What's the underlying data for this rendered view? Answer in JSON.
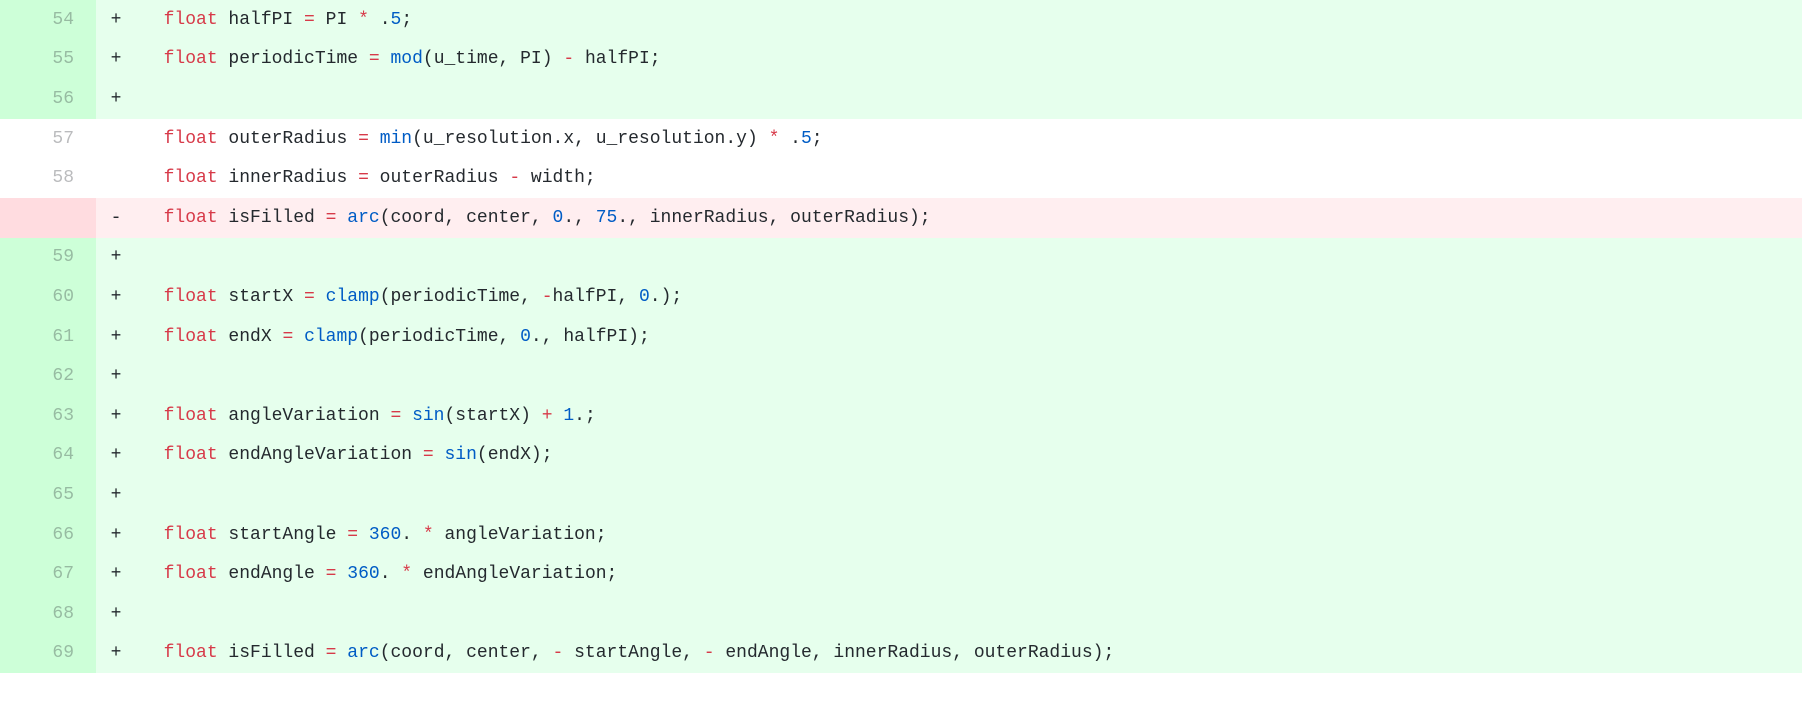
{
  "diff": {
    "lines": [
      {
        "id": "l54",
        "lineno": "54",
        "marker": "+",
        "kind": "add",
        "tokens": [
          {
            "cls": "tok-plain",
            "t": "  "
          },
          {
            "cls": "tok-red",
            "t": "float"
          },
          {
            "cls": "tok-plain",
            "t": " halfPI "
          },
          {
            "cls": "tok-red",
            "t": "="
          },
          {
            "cls": "tok-plain",
            "t": " PI "
          },
          {
            "cls": "tok-red",
            "t": "*"
          },
          {
            "cls": "tok-plain",
            "t": " ."
          },
          {
            "cls": "tok-blue",
            "t": "5"
          },
          {
            "cls": "tok-plain",
            "t": ";"
          }
        ]
      },
      {
        "id": "l55",
        "lineno": "55",
        "marker": "+",
        "kind": "add",
        "tokens": [
          {
            "cls": "tok-plain",
            "t": "  "
          },
          {
            "cls": "tok-red",
            "t": "float"
          },
          {
            "cls": "tok-plain",
            "t": " periodicTime "
          },
          {
            "cls": "tok-red",
            "t": "="
          },
          {
            "cls": "tok-plain",
            "t": " "
          },
          {
            "cls": "tok-blue",
            "t": "mod"
          },
          {
            "cls": "tok-plain",
            "t": "(u_time, PI) "
          },
          {
            "cls": "tok-red",
            "t": "-"
          },
          {
            "cls": "tok-plain",
            "t": " halfPI;"
          }
        ]
      },
      {
        "id": "l56",
        "lineno": "56",
        "marker": "+",
        "kind": "add",
        "tokens": []
      },
      {
        "id": "l57",
        "lineno": "57",
        "marker": "",
        "kind": "ctx",
        "tokens": [
          {
            "cls": "tok-plain",
            "t": "  "
          },
          {
            "cls": "tok-red",
            "t": "float"
          },
          {
            "cls": "tok-plain",
            "t": " outerRadius "
          },
          {
            "cls": "tok-red",
            "t": "="
          },
          {
            "cls": "tok-plain",
            "t": " "
          },
          {
            "cls": "tok-blue",
            "t": "min"
          },
          {
            "cls": "tok-plain",
            "t": "(u_resolution.x, u_resolution.y) "
          },
          {
            "cls": "tok-red",
            "t": "*"
          },
          {
            "cls": "tok-plain",
            "t": " ."
          },
          {
            "cls": "tok-blue",
            "t": "5"
          },
          {
            "cls": "tok-plain",
            "t": ";"
          }
        ]
      },
      {
        "id": "l58",
        "lineno": "58",
        "marker": "",
        "kind": "ctx",
        "tokens": [
          {
            "cls": "tok-plain",
            "t": "  "
          },
          {
            "cls": "tok-red",
            "t": "float"
          },
          {
            "cls": "tok-plain",
            "t": " innerRadius "
          },
          {
            "cls": "tok-red",
            "t": "="
          },
          {
            "cls": "tok-plain",
            "t": " outerRadius "
          },
          {
            "cls": "tok-red",
            "t": "-"
          },
          {
            "cls": "tok-plain",
            "t": " width;"
          }
        ]
      },
      {
        "id": "ldel",
        "lineno": "",
        "marker": "-",
        "kind": "del",
        "tokens": [
          {
            "cls": "tok-plain",
            "t": "  "
          },
          {
            "cls": "tok-red",
            "t": "float"
          },
          {
            "cls": "tok-plain",
            "t": " isFilled "
          },
          {
            "cls": "tok-red",
            "t": "="
          },
          {
            "cls": "tok-plain",
            "t": " "
          },
          {
            "cls": "tok-blue",
            "t": "arc"
          },
          {
            "cls": "tok-plain",
            "t": "(coord, center, "
          },
          {
            "cls": "tok-blue",
            "t": "0"
          },
          {
            "cls": "tok-plain",
            "t": "., "
          },
          {
            "cls": "tok-blue",
            "t": "75"
          },
          {
            "cls": "tok-plain",
            "t": "., innerRadius, outerRadius);"
          }
        ]
      },
      {
        "id": "l59",
        "lineno": "59",
        "marker": "+",
        "kind": "add",
        "tokens": []
      },
      {
        "id": "l60",
        "lineno": "60",
        "marker": "+",
        "kind": "add",
        "tokens": [
          {
            "cls": "tok-plain",
            "t": "  "
          },
          {
            "cls": "tok-red",
            "t": "float"
          },
          {
            "cls": "tok-plain",
            "t": " startX "
          },
          {
            "cls": "tok-red",
            "t": "="
          },
          {
            "cls": "tok-plain",
            "t": " "
          },
          {
            "cls": "tok-blue",
            "t": "clamp"
          },
          {
            "cls": "tok-plain",
            "t": "(periodicTime, "
          },
          {
            "cls": "tok-red",
            "t": "-"
          },
          {
            "cls": "tok-plain",
            "t": "halfPI, "
          },
          {
            "cls": "tok-blue",
            "t": "0"
          },
          {
            "cls": "tok-plain",
            "t": ".);"
          }
        ]
      },
      {
        "id": "l61",
        "lineno": "61",
        "marker": "+",
        "kind": "add",
        "tokens": [
          {
            "cls": "tok-plain",
            "t": "  "
          },
          {
            "cls": "tok-red",
            "t": "float"
          },
          {
            "cls": "tok-plain",
            "t": " endX "
          },
          {
            "cls": "tok-red",
            "t": "="
          },
          {
            "cls": "tok-plain",
            "t": " "
          },
          {
            "cls": "tok-blue",
            "t": "clamp"
          },
          {
            "cls": "tok-plain",
            "t": "(periodicTime, "
          },
          {
            "cls": "tok-blue",
            "t": "0"
          },
          {
            "cls": "tok-plain",
            "t": "., halfPI);"
          }
        ]
      },
      {
        "id": "l62",
        "lineno": "62",
        "marker": "+",
        "kind": "add",
        "tokens": []
      },
      {
        "id": "l63",
        "lineno": "63",
        "marker": "+",
        "kind": "add",
        "tokens": [
          {
            "cls": "tok-plain",
            "t": "  "
          },
          {
            "cls": "tok-red",
            "t": "float"
          },
          {
            "cls": "tok-plain",
            "t": " angleVariation "
          },
          {
            "cls": "tok-red",
            "t": "="
          },
          {
            "cls": "tok-plain",
            "t": " "
          },
          {
            "cls": "tok-blue",
            "t": "sin"
          },
          {
            "cls": "tok-plain",
            "t": "(startX) "
          },
          {
            "cls": "tok-red",
            "t": "+"
          },
          {
            "cls": "tok-plain",
            "t": " "
          },
          {
            "cls": "tok-blue",
            "t": "1"
          },
          {
            "cls": "tok-plain",
            "t": ".;"
          }
        ]
      },
      {
        "id": "l64",
        "lineno": "64",
        "marker": "+",
        "kind": "add",
        "tokens": [
          {
            "cls": "tok-plain",
            "t": "  "
          },
          {
            "cls": "tok-red",
            "t": "float"
          },
          {
            "cls": "tok-plain",
            "t": " endAngleVariation "
          },
          {
            "cls": "tok-red",
            "t": "="
          },
          {
            "cls": "tok-plain",
            "t": " "
          },
          {
            "cls": "tok-blue",
            "t": "sin"
          },
          {
            "cls": "tok-plain",
            "t": "(endX);"
          }
        ]
      },
      {
        "id": "l65",
        "lineno": "65",
        "marker": "+",
        "kind": "add",
        "tokens": []
      },
      {
        "id": "l66",
        "lineno": "66",
        "marker": "+",
        "kind": "add",
        "tokens": [
          {
            "cls": "tok-plain",
            "t": "  "
          },
          {
            "cls": "tok-red",
            "t": "float"
          },
          {
            "cls": "tok-plain",
            "t": " startAngle "
          },
          {
            "cls": "tok-red",
            "t": "="
          },
          {
            "cls": "tok-plain",
            "t": " "
          },
          {
            "cls": "tok-blue",
            "t": "360"
          },
          {
            "cls": "tok-plain",
            "t": ". "
          },
          {
            "cls": "tok-red",
            "t": "*"
          },
          {
            "cls": "tok-plain",
            "t": " angleVariation;"
          }
        ]
      },
      {
        "id": "l67",
        "lineno": "67",
        "marker": "+",
        "kind": "add",
        "tokens": [
          {
            "cls": "tok-plain",
            "t": "  "
          },
          {
            "cls": "tok-red",
            "t": "float"
          },
          {
            "cls": "tok-plain",
            "t": " endAngle "
          },
          {
            "cls": "tok-red",
            "t": "="
          },
          {
            "cls": "tok-plain",
            "t": " "
          },
          {
            "cls": "tok-blue",
            "t": "360"
          },
          {
            "cls": "tok-plain",
            "t": ". "
          },
          {
            "cls": "tok-red",
            "t": "*"
          },
          {
            "cls": "tok-plain",
            "t": " endAngleVariation;"
          }
        ]
      },
      {
        "id": "l68",
        "lineno": "68",
        "marker": "+",
        "kind": "add",
        "tokens": []
      },
      {
        "id": "l69",
        "lineno": "69",
        "marker": "+",
        "kind": "add",
        "tokens": [
          {
            "cls": "tok-plain",
            "t": "  "
          },
          {
            "cls": "tok-red",
            "t": "float"
          },
          {
            "cls": "tok-plain",
            "t": " isFilled "
          },
          {
            "cls": "tok-red",
            "t": "="
          },
          {
            "cls": "tok-plain",
            "t": " "
          },
          {
            "cls": "tok-blue",
            "t": "arc"
          },
          {
            "cls": "tok-plain",
            "t": "(coord, center, "
          },
          {
            "cls": "tok-red",
            "t": "-"
          },
          {
            "cls": "tok-plain",
            "t": " startAngle, "
          },
          {
            "cls": "tok-red",
            "t": "-"
          },
          {
            "cls": "tok-plain",
            "t": " endAngle, innerRadius, outerRadius);"
          }
        ]
      }
    ]
  }
}
